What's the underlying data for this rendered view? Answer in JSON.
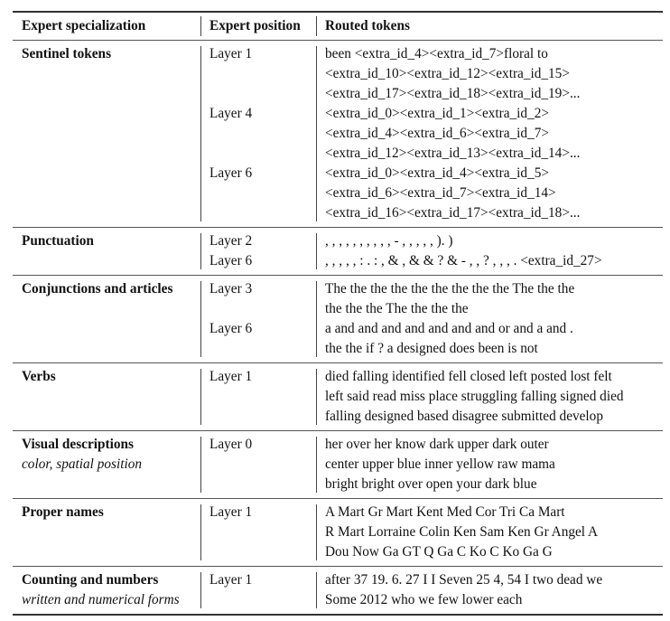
{
  "table": {
    "headers": [
      "Expert specialization",
      "Expert position",
      "Routed tokens"
    ],
    "rows": [
      {
        "specialization": "Sentinel tokens",
        "subtitle": "",
        "groups": [
          {
            "layer": "Layer 1",
            "tokens": [
              "been <extra_id_4><extra_id_7>floral to",
              "<extra_id_10><extra_id_12><extra_id_15>",
              "<extra_id_17><extra_id_18><extra_id_19>..."
            ]
          },
          {
            "layer": "Layer 4",
            "tokens": [
              "<extra_id_0><extra_id_1><extra_id_2>",
              "<extra_id_4><extra_id_6><extra_id_7>",
              "<extra_id_12><extra_id_13><extra_id_14>..."
            ]
          },
          {
            "layer": "Layer 6",
            "tokens": [
              "<extra_id_0><extra_id_4><extra_id_5>",
              "<extra_id_6><extra_id_7><extra_id_14>",
              "<extra_id_16><extra_id_17><extra_id_18>..."
            ]
          }
        ]
      },
      {
        "specialization": "Punctuation",
        "subtitle": "",
        "groups": [
          {
            "layer": "Layer 2",
            "tokens": [
              ", , , , , , , , , , - , , , , , ). )"
            ]
          },
          {
            "layer": "Layer 6",
            "tokens": [
              ", , , , , : . : , & , & & ? & - , , ? , , , . <extra_id_27>"
            ]
          }
        ]
      },
      {
        "specialization": "Conjunctions and articles",
        "subtitle": "",
        "groups": [
          {
            "layer": "Layer 3",
            "tokens": [
              "The the the the the the the the the The the the",
              "the the the The the the the"
            ]
          },
          {
            "layer": "Layer 6",
            "tokens": [
              "a and and and and and and and or and a and .",
              "the the if ? a designed does been is not"
            ]
          }
        ]
      },
      {
        "specialization": "Verbs",
        "subtitle": "",
        "groups": [
          {
            "layer": "Layer 1",
            "tokens": [
              "died falling identified fell closed left posted lost felt",
              "left said read miss place struggling falling signed died",
              "falling designed based disagree submitted develop"
            ]
          }
        ]
      },
      {
        "specialization": "Visual descriptions",
        "subtitle": "color, spatial position",
        "groups": [
          {
            "layer": "Layer 0",
            "tokens": [
              "her over her know dark upper dark outer",
              "center upper blue inner yellow raw mama",
              "bright bright over open your dark blue"
            ]
          }
        ]
      },
      {
        "specialization": "Proper names",
        "subtitle": "",
        "groups": [
          {
            "layer": "Layer 1",
            "tokens": [
              "A Mart Gr Mart Kent Med Cor Tri Ca Mart",
              "R Mart Lorraine Colin Ken Sam Ken Gr Angel A",
              "Dou Now Ga GT Q Ga C Ko C Ko Ga G"
            ]
          }
        ]
      },
      {
        "specialization": "Counting and numbers",
        "subtitle": "written and numerical forms",
        "groups": [
          {
            "layer": "Layer 1",
            "tokens": [
              "after 37 19. 6. 27 I I Seven 25 4, 54 I two dead we",
              "Some 2012 who we few lower each"
            ]
          }
        ]
      }
    ]
  }
}
